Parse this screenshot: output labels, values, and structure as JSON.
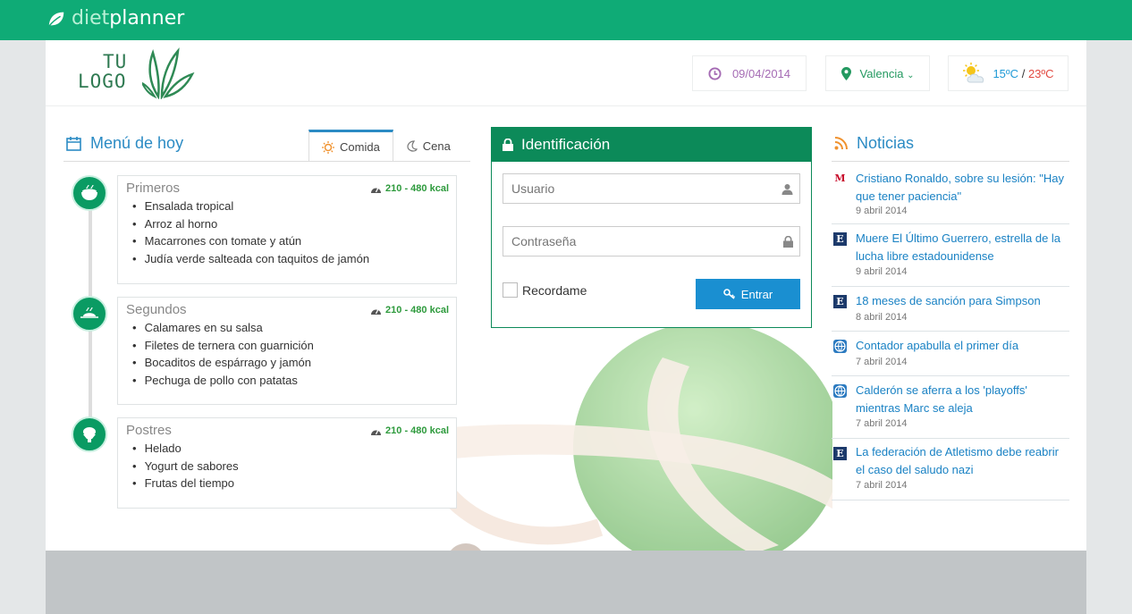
{
  "brand": {
    "diet": "diet",
    "planner": "planner"
  },
  "logo": {
    "line1": "TU",
    "line2": "LOGO"
  },
  "header": {
    "date": "09/04/2014",
    "city": "Valencia",
    "weather": {
      "high": "15ºC",
      "separator": "/",
      "low": "23ºC"
    }
  },
  "menu": {
    "title": "Menú de hoy",
    "tabs": [
      {
        "label": "Comida"
      },
      {
        "label": "Cena"
      }
    ],
    "sections": [
      {
        "title": "Primeros",
        "kcal": "210 - 480 kcal",
        "items": [
          "Ensalada tropical",
          "Arroz al horno",
          "Macarrones con tomate y atún",
          "Judía verde salteada con taquitos de jamón"
        ]
      },
      {
        "title": "Segundos",
        "kcal": "210 - 480 kcal",
        "items": [
          "Calamares en su salsa",
          "Filetes de ternera con guarnición",
          "Bocaditos de espárrago y jamón",
          "Pechuga de pollo con patatas"
        ]
      },
      {
        "title": "Postres",
        "kcal": "210 - 480 kcal",
        "items": [
          "Helado",
          "Yogurt de sabores",
          "Frutas del tiempo"
        ]
      }
    ]
  },
  "login": {
    "title": "Identificación",
    "user_placeholder": "Usuario",
    "pass_placeholder": "Contraseña",
    "remember_label": "Recordame",
    "submit_label": "Entrar"
  },
  "news": {
    "title": "Noticias",
    "items": [
      {
        "source": "M",
        "headline": "Cristiano Ronaldo, sobre su lesión: \"Hay que tener paciencia\"",
        "date": "9 abril 2014"
      },
      {
        "source": "E",
        "headline": "Muere El Último Guerrero, estrella de la lucha libre estadounidense",
        "date": "9 abril 2014"
      },
      {
        "source": "E",
        "headline": "18 meses de sanción para Simpson",
        "date": "8 abril 2014"
      },
      {
        "source": "",
        "headline": "Contador apabulla el primer día",
        "date": "7 abril 2014"
      },
      {
        "source": "",
        "headline": "Calderón se aferra a los 'playoffs' mientras Marc se aleja",
        "date": "7 abril 2014"
      },
      {
        "source": "E",
        "headline": "La federación de Atletismo debe reabrir el caso del saludo nazi",
        "date": "7 abril 2014"
      }
    ]
  },
  "colors": {
    "brand_green": "#0fab76",
    "login_green": "#0c8a59",
    "link_blue": "#1a82c4",
    "kcal_green": "#2d9a3c"
  }
}
